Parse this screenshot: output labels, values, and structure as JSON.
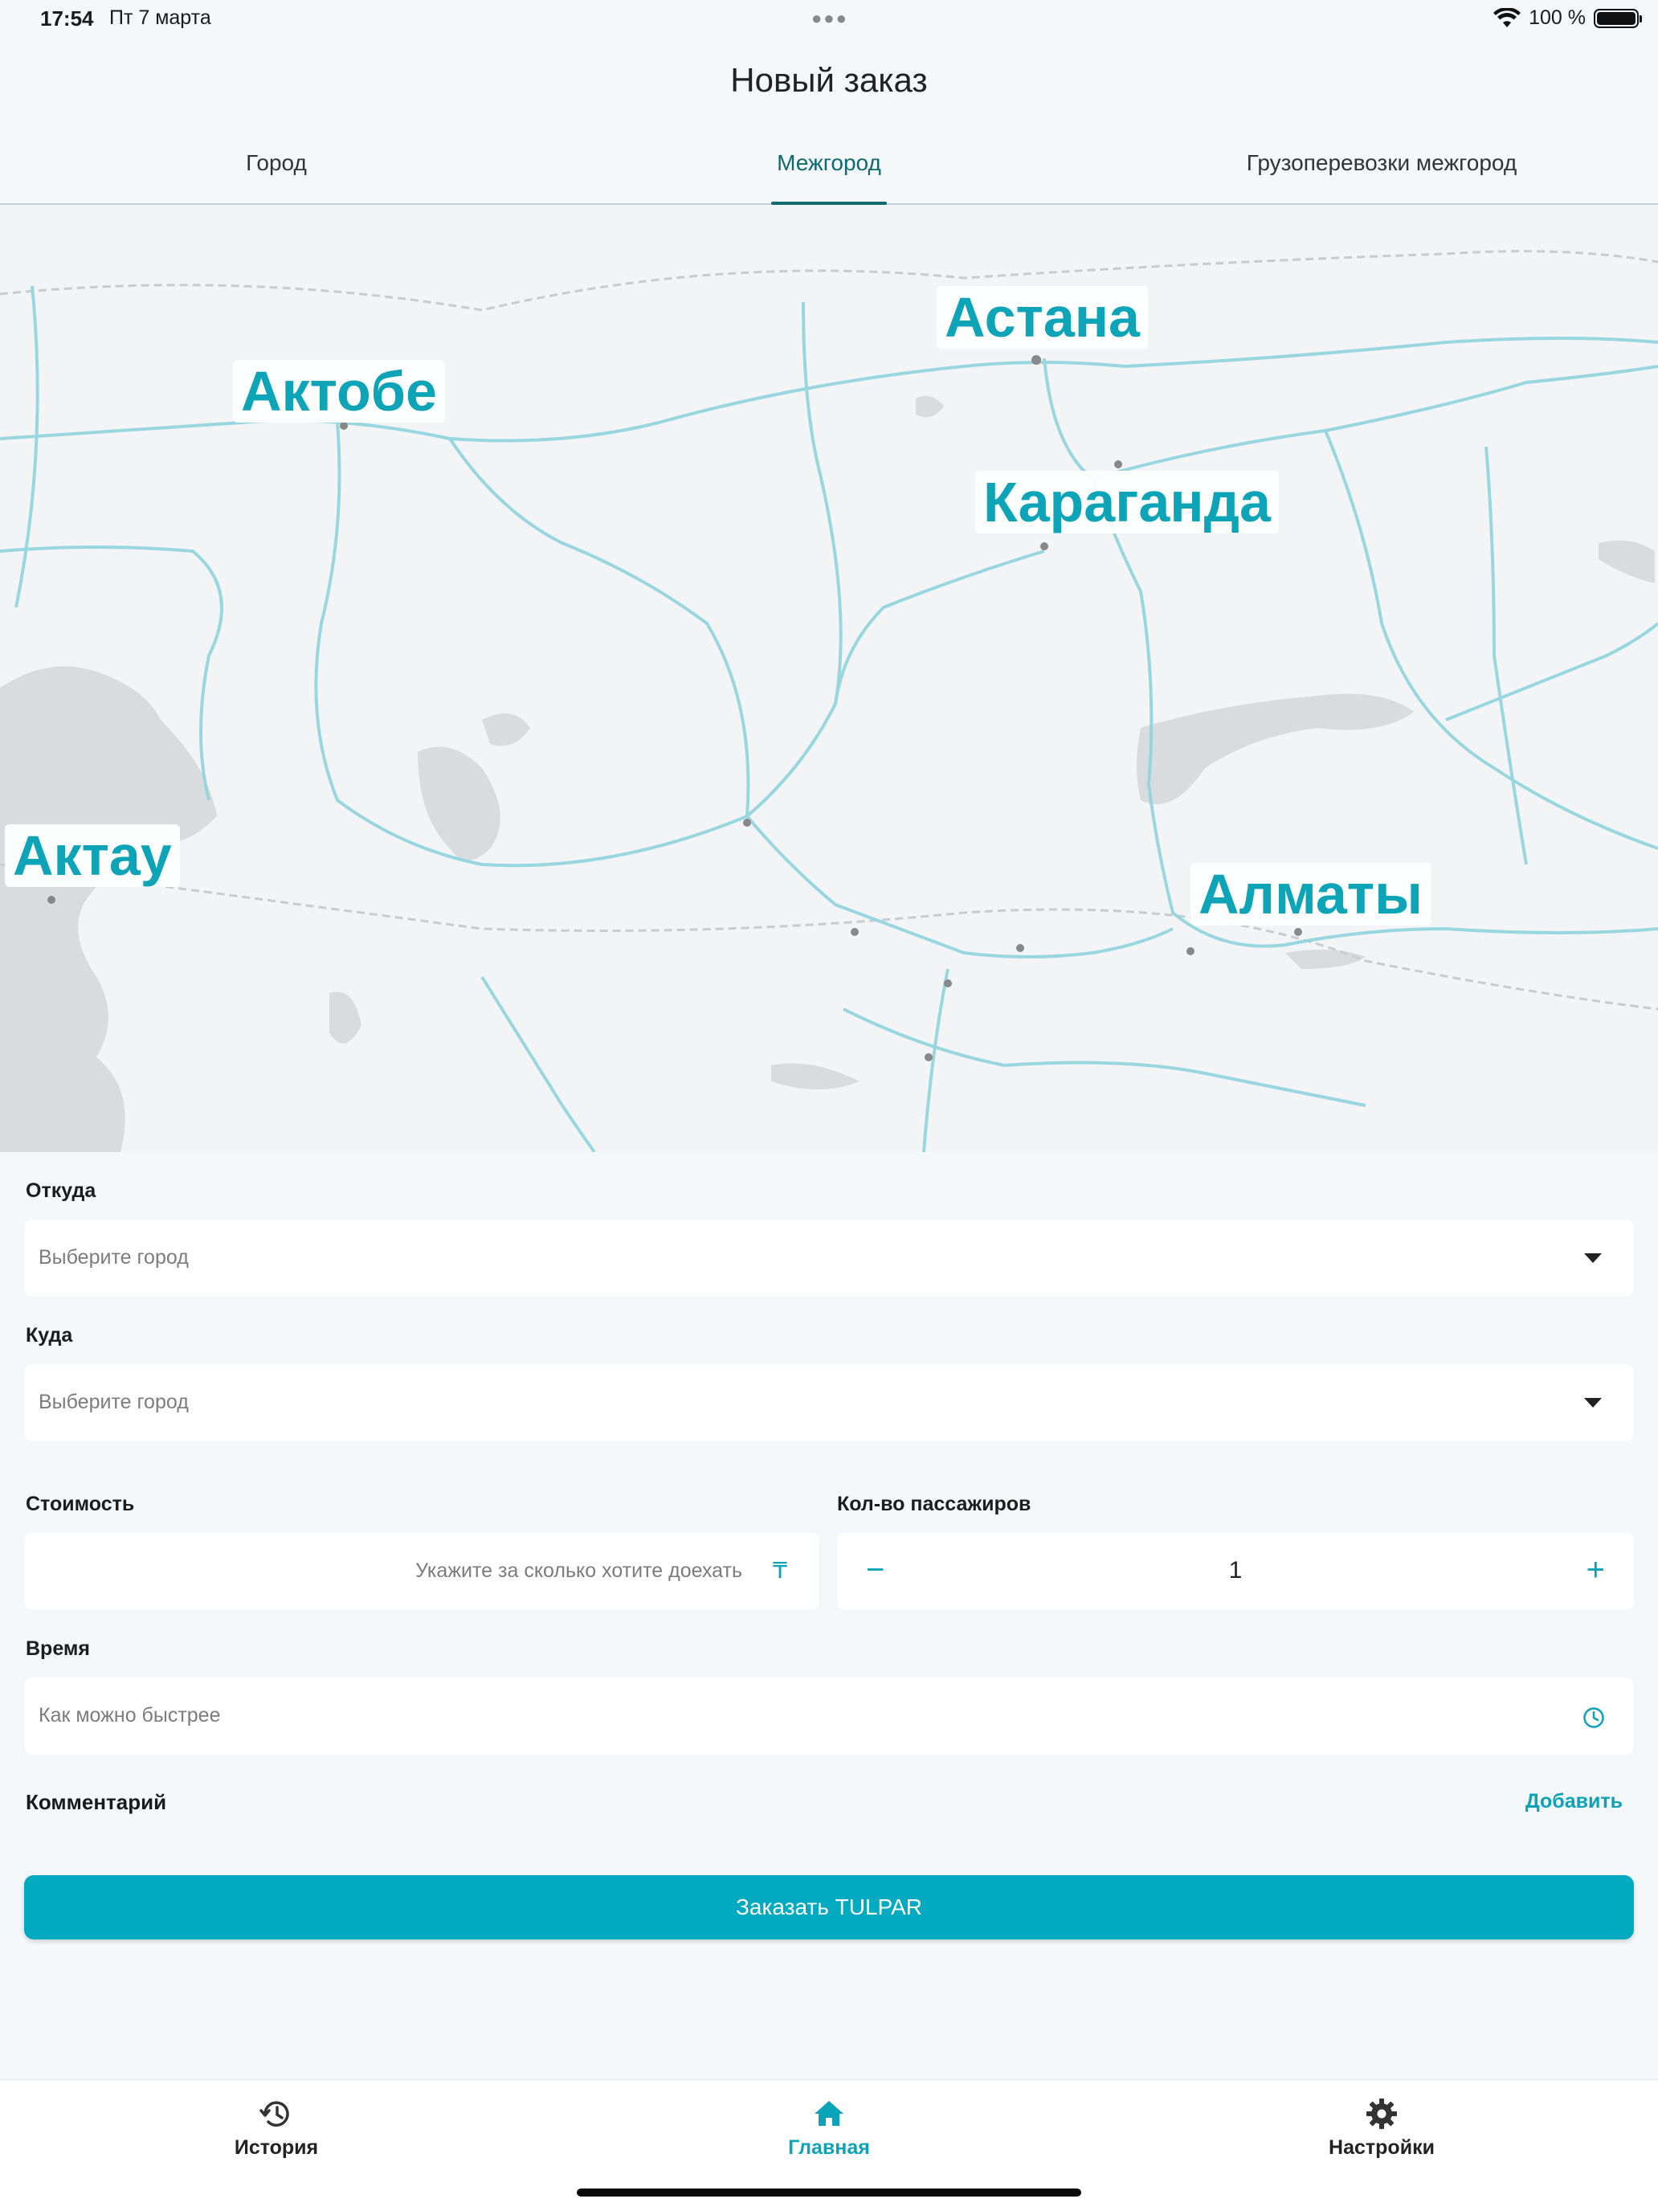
{
  "status_bar": {
    "time": "17:54",
    "date": "Пт 7 марта",
    "battery": "100 %",
    "battery_level": 1.0
  },
  "header": {
    "title": "Новый заказ"
  },
  "tabs": [
    {
      "label": "Город",
      "active": false
    },
    {
      "label": "Межгород",
      "active": true
    },
    {
      "label": "Грузоперевозки межгород",
      "active": false
    }
  ],
  "map": {
    "cities": [
      {
        "name": "Астана"
      },
      {
        "name": "Актобе"
      },
      {
        "name": "Караганда"
      },
      {
        "name": "Актау"
      },
      {
        "name": "Алматы"
      }
    ]
  },
  "form": {
    "from": {
      "label": "Откуда",
      "placeholder": "Выберите город"
    },
    "to": {
      "label": "Куда",
      "placeholder": "Выберите город"
    },
    "price": {
      "label": "Стоимость",
      "placeholder": "Укажите за сколько хотите доехать",
      "currency_icon": "tenge-icon"
    },
    "passengers": {
      "label": "Кол-во пассажиров",
      "value": "1",
      "minus": "−",
      "plus": "+"
    },
    "time": {
      "label": "Время",
      "placeholder": "Как можно быстрее"
    },
    "comment": {
      "label": "Комментарий",
      "action": "Добавить"
    },
    "submit": "Заказать TULPAR"
  },
  "bottom_nav": [
    {
      "label": "История",
      "icon": "history-icon",
      "active": false
    },
    {
      "label": "Главная",
      "icon": "home-icon",
      "active": true
    },
    {
      "label": "Настройки",
      "icon": "gear-icon",
      "active": false
    }
  ],
  "colors": {
    "accent": "#01a9c1",
    "tab_active": "#0e6a6f",
    "background": "#f4f8fa"
  }
}
